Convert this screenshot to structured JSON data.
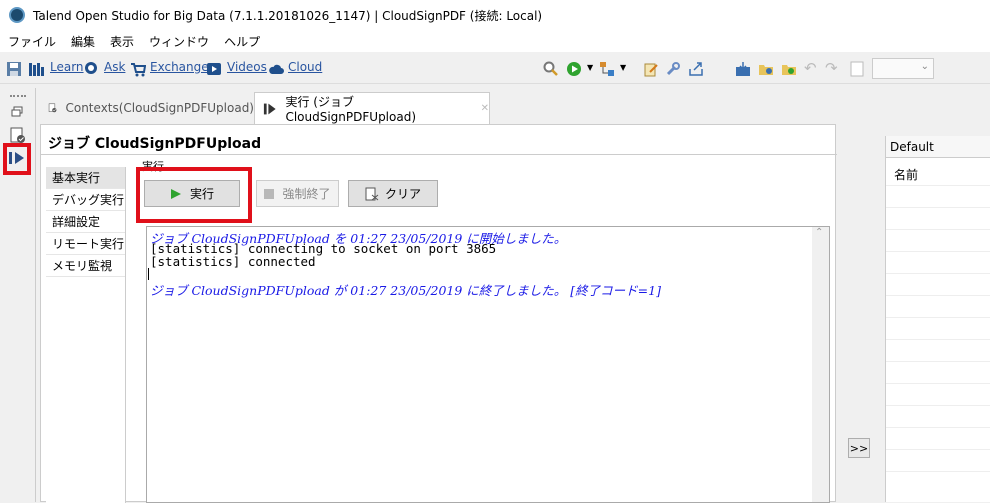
{
  "window": {
    "title": "Talend Open Studio for Big Data (7.1.1.20181026_1147) | CloudSignPDF (接続: Local)"
  },
  "menu": [
    "ファイル",
    "編集",
    "表示",
    "ウィンドウ",
    "ヘルプ"
  ],
  "toolbar": {
    "links": {
      "learn": "Learn",
      "ask": "Ask",
      "exchange": "Exchange",
      "videos": "Videos",
      "cloud": "Cloud"
    }
  },
  "tabs": {
    "contexts": "Contexts(CloudSignPDFUpload)",
    "run": "実行 (ジョブ CloudSignPDFUpload)"
  },
  "editor": {
    "job_title": "ジョブ CloudSignPDFUpload",
    "section_label": "実行",
    "nav": [
      "基本実行",
      "デバッグ実行",
      "詳細設定",
      "リモート実行",
      "メモリ監視"
    ],
    "buttons": {
      "run": "実行",
      "kill": "強制終了",
      "clear": "クリア"
    }
  },
  "console": {
    "lines": [
      "ジョブ CloudSignPDFUpload を 01:27 23/05/2019 に開始しました。",
      "[statistics] connecting to socket on port 3865",
      "[statistics] connected",
      "ジョブ CloudSignPDFUpload が 01:27 23/05/2019 に終了しました。 [終了コード=1]"
    ]
  },
  "right_panel": {
    "header": "Default",
    "column": "名前"
  },
  "arrow_button": ">>",
  "colors": {
    "highlight": "#e0101a",
    "console_info": "#1a1ae6",
    "link": "#2955a0"
  }
}
